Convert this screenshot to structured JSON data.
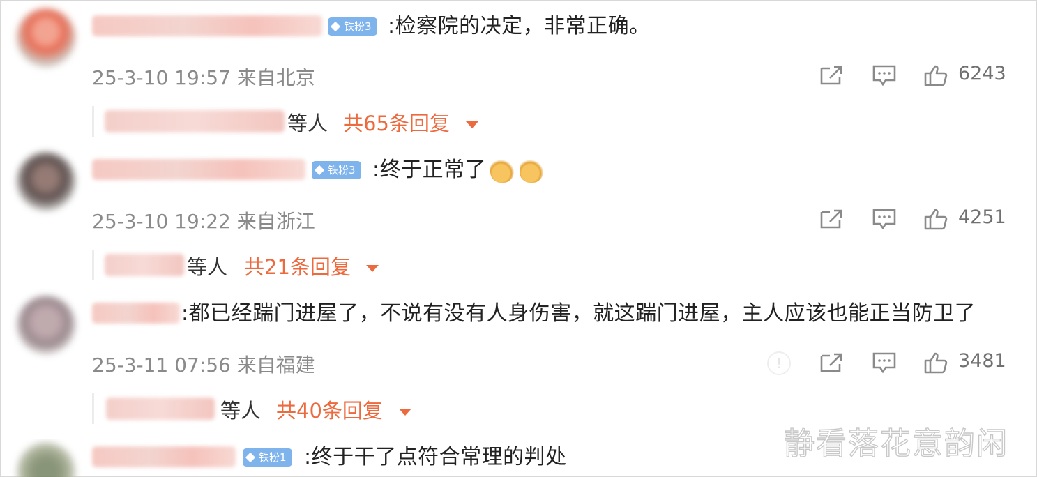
{
  "comments": [
    {
      "badge": "铁粉3",
      "text": ":检察院的决定，非常正确。",
      "time": "25-3-10 19:57",
      "location": "来自北京",
      "likes": "6243",
      "reply_suffix": "等人",
      "reply_count": "共65条回复"
    },
    {
      "badge": "铁粉3",
      "text": ":终于正常了",
      "time": "25-3-10 19:22",
      "location": "来自浙江",
      "likes": "4251",
      "reply_suffix": "等人",
      "reply_count": "共21条回复"
    },
    {
      "badge": "",
      "text": ":都已经踹门进屋了，不说有没有人身伤害，就这踹门进屋，主人应该也能正当防卫了",
      "time": "25-3-11 07:56",
      "location": "来自福建",
      "likes": "3481",
      "reply_suffix": "等人",
      "reply_count": "共40条回复"
    },
    {
      "badge": "铁粉1",
      "text": ":终于干了点符合常理的判处"
    }
  ],
  "watermark": "静看落花意韵闲",
  "colors": {
    "accent": "#ec6a3e",
    "badge": "#7fb3ec",
    "meta": "#8a8a8a"
  },
  "icons": [
    "share-icon",
    "comment-icon",
    "like-icon",
    "caret-down-icon",
    "report-icon",
    "diamond-icon"
  ]
}
